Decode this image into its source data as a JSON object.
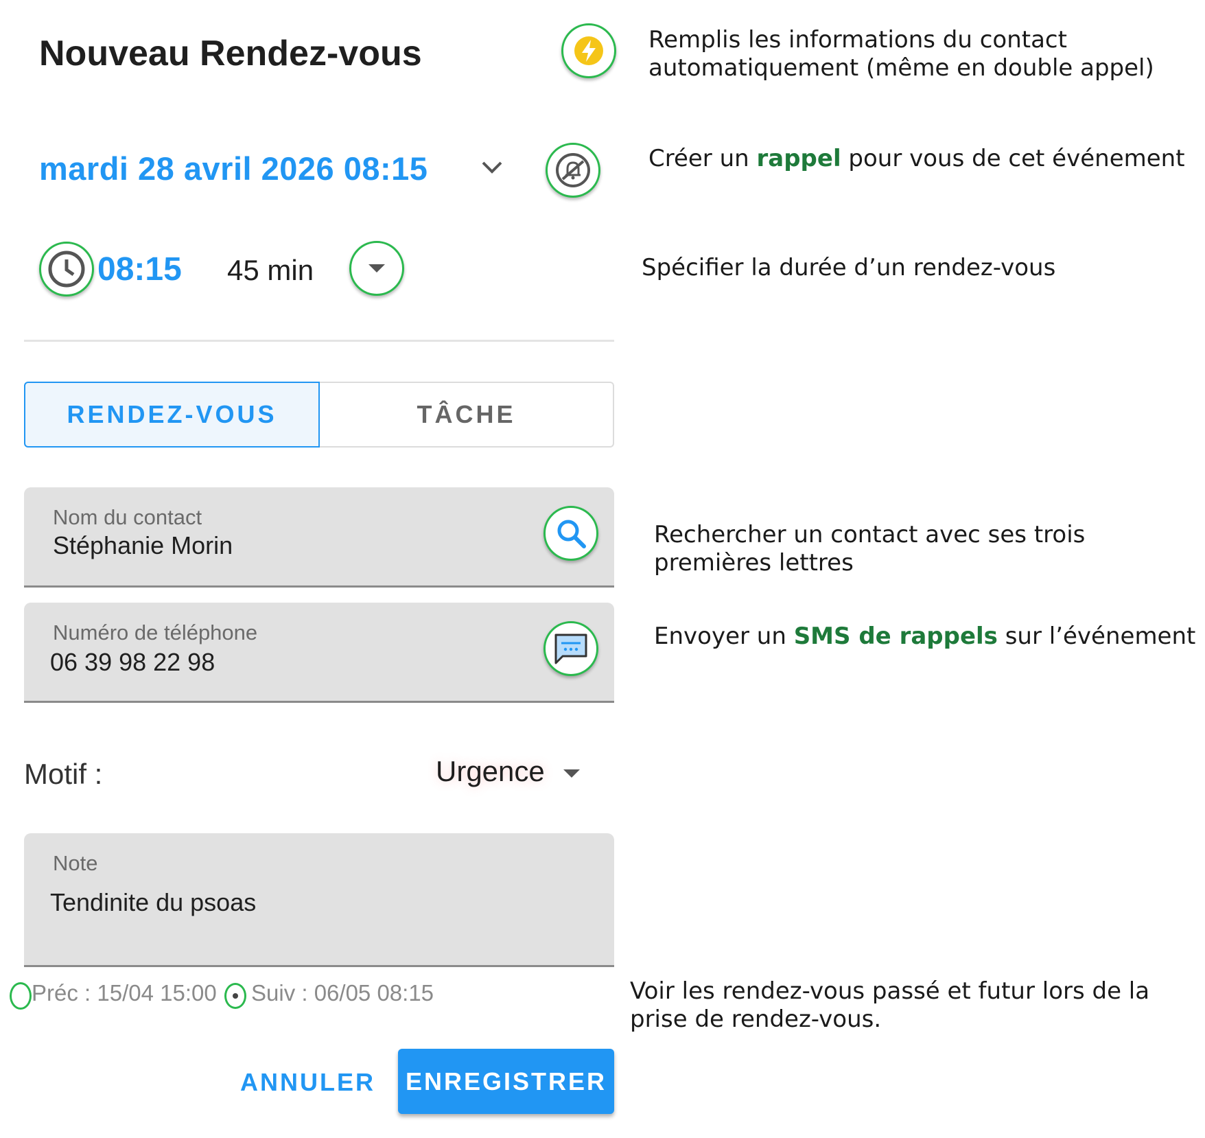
{
  "header": {
    "title": "Nouveau Rendez-vous"
  },
  "datetime": {
    "date": "mardi 28 avril 2026 08:15",
    "time": "08:15",
    "duration": "45 min"
  },
  "type_toggle": {
    "options": [
      {
        "label": "RENDEZ-VOUS",
        "selected": true
      },
      {
        "label": "TÂCHE",
        "selected": false
      }
    ]
  },
  "contact": {
    "label": "Nom du contact",
    "value": "Stéphanie Morin"
  },
  "phone": {
    "label": "Numéro de téléphone",
    "value": "06 39 98 22 98"
  },
  "motif": {
    "label": "Motif :",
    "value": "Urgence"
  },
  "note": {
    "label": "Note",
    "value": "Tendinite du psoas"
  },
  "navigation": {
    "prev": "Préc : 15/04 15:00",
    "next": "Suiv : 06/05 08:15"
  },
  "actions": {
    "cancel": "ANNULER",
    "save": "ENREGISTRER"
  },
  "annotations": {
    "autofill": "Remplis les informations du contact automatiquement (même en double appel)",
    "reminder": {
      "before": "Créer un ",
      "highlight": "rappel",
      "after": " pour vous de cet événement"
    },
    "duration": "Spécifier la durée d’un rendez-vous",
    "search": "Rechercher un contact avec ses trois premières lettres",
    "sms": {
      "before": "Envoyer un ",
      "highlight": "SMS de rappels",
      "after": " sur l’événement"
    },
    "history": "Voir les rendez-vous passé et futur lors de la prise de rendez-vous."
  },
  "colors": {
    "accent": "#2196f3",
    "highlight_ring": "#2bb94e",
    "annotation_highlight": "#1e7a3a",
    "bolt": "#f5c518"
  },
  "icons": [
    "lightning-icon",
    "chevron-down-icon",
    "bell-off-icon",
    "clock-icon",
    "dropdown-arrow-icon",
    "search-icon",
    "sms-icon",
    "arrow-drop-down-icon"
  ]
}
